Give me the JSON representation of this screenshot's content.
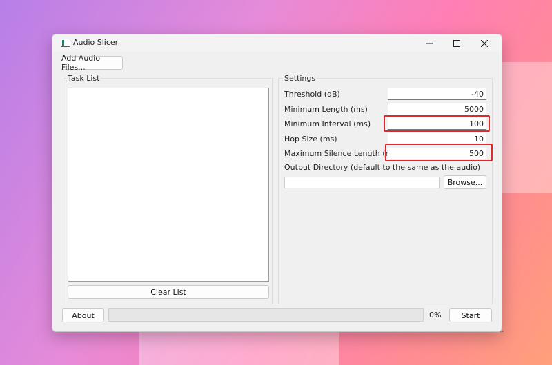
{
  "window": {
    "title": "Audio Slicer"
  },
  "toolbar": {
    "add_files_label": "Add Audio Files..."
  },
  "task_list": {
    "group_label": "Task List",
    "clear_label": "Clear List"
  },
  "settings": {
    "group_label": "Settings",
    "fields": [
      {
        "label": "Threshold (dB)",
        "value": "-40",
        "highlighted": false
      },
      {
        "label": "Minimum Length (ms)",
        "value": "5000",
        "highlighted": false
      },
      {
        "label": "Minimum Interval (ms)",
        "value": "100",
        "highlighted": true
      },
      {
        "label": "Hop Size (ms)",
        "value": "10",
        "highlighted": false
      },
      {
        "label": "Maximum Silence Length (ms)",
        "value": "500",
        "highlighted": true
      }
    ],
    "output_dir_label": "Output Directory (default to the same as the audio)",
    "output_dir_value": "",
    "browse_label": "Browse..."
  },
  "footer": {
    "about_label": "About",
    "progress_percent": 0,
    "progress_text": "0%",
    "start_label": "Start"
  },
  "background": {
    "behind_text": "Browse..."
  },
  "colors": {
    "highlight": "#e3262b",
    "progress": "#3a9e4a"
  }
}
